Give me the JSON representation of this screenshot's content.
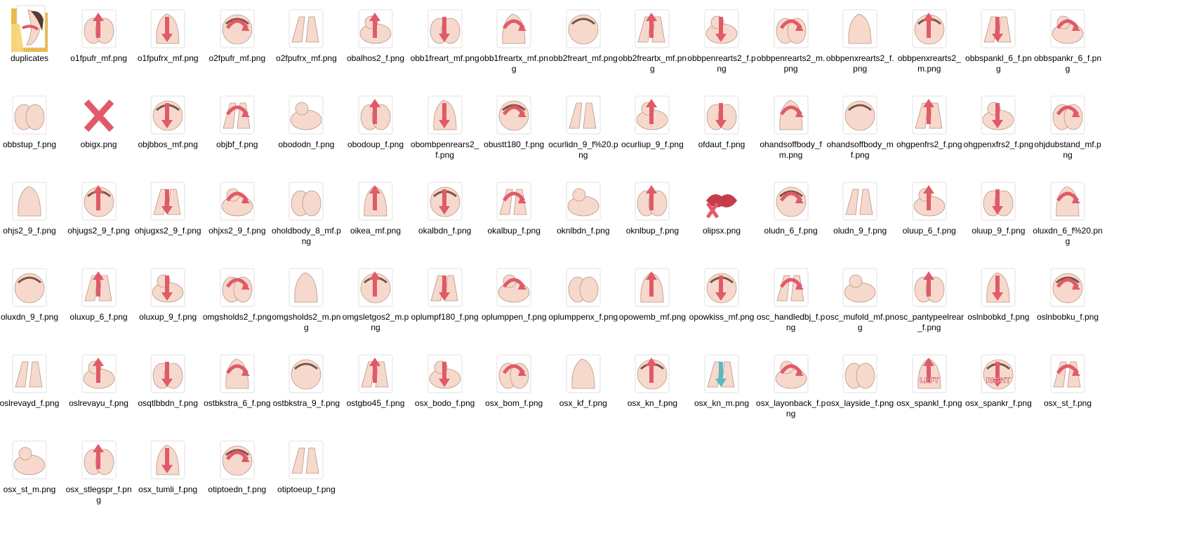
{
  "folder": {
    "label": "duplicates",
    "icon": "folder-icon"
  },
  "files": [
    {
      "name": "o1fpufr_mf.png",
      "icon": "image-thumbnail-icon"
    },
    {
      "name": "o1fpufrx_mf.png",
      "icon": "image-thumbnail-icon"
    },
    {
      "name": "o2fpufr_mf.png",
      "icon": "image-thumbnail-icon"
    },
    {
      "name": "o2fpufrx_mf.png",
      "icon": "image-thumbnail-icon"
    },
    {
      "name": "obalhos2_f.png",
      "icon": "image-thumbnail-icon"
    },
    {
      "name": "obb1freart_mf.png",
      "icon": "image-thumbnail-icon"
    },
    {
      "name": "obb1freartx_mf.png",
      "icon": "image-thumbnail-icon"
    },
    {
      "name": "obb2freart_mf.png",
      "icon": "image-thumbnail-icon"
    },
    {
      "name": "obb2freartx_mf.png",
      "icon": "image-thumbnail-icon"
    },
    {
      "name": "obbpenrearts2_f.png",
      "icon": "image-thumbnail-icon"
    },
    {
      "name": "obbpenrearts2_m.png",
      "icon": "image-thumbnail-icon"
    },
    {
      "name": "obbpenxrearts2_f.png",
      "icon": "image-thumbnail-icon"
    },
    {
      "name": "obbpenxrearts2_m.png",
      "icon": "image-thumbnail-icon"
    },
    {
      "name": "obbspankl_6_f.png",
      "icon": "image-thumbnail-icon"
    },
    {
      "name": "obbspankr_6_f.png",
      "icon": "image-thumbnail-icon"
    },
    {
      "name": "obbstup_f.png",
      "icon": "image-thumbnail-icon"
    },
    {
      "name": "obigx.png",
      "icon": "image-thumbnail-icon"
    },
    {
      "name": "objbbos_mf.png",
      "icon": "image-thumbnail-icon"
    },
    {
      "name": "objbf_f.png",
      "icon": "image-thumbnail-icon"
    },
    {
      "name": "obododn_f.png",
      "icon": "image-thumbnail-icon"
    },
    {
      "name": "obodoup_f.png",
      "icon": "image-thumbnail-icon"
    },
    {
      "name": "obombpenrears2_f.png",
      "icon": "image-thumbnail-icon"
    },
    {
      "name": "obustt180_f.png",
      "icon": "image-thumbnail-icon"
    },
    {
      "name": "ocurlidn_9_f%20.png",
      "icon": "image-thumbnail-icon"
    },
    {
      "name": "ocurliup_9_f.png",
      "icon": "image-thumbnail-icon"
    },
    {
      "name": "ofdaut_f.png",
      "icon": "image-thumbnail-icon"
    },
    {
      "name": "ohandsoffbody_fm.png",
      "icon": "image-thumbnail-icon"
    },
    {
      "name": "ohandsoffbody_mf.png",
      "icon": "image-thumbnail-icon"
    },
    {
      "name": "ohgpenfrs2_f.png",
      "icon": "image-thumbnail-icon"
    },
    {
      "name": "ohgpenxfrs2_f.png",
      "icon": "image-thumbnail-icon"
    },
    {
      "name": "ohjdubstand_mf.png",
      "icon": "image-thumbnail-icon"
    },
    {
      "name": "ohjs2_9_f.png",
      "icon": "image-thumbnail-icon"
    },
    {
      "name": "ohjugs2_9_f.png",
      "icon": "image-thumbnail-icon"
    },
    {
      "name": "ohjugxs2_9_f.png",
      "icon": "image-thumbnail-icon"
    },
    {
      "name": "ohjxs2_9_f.png",
      "icon": "image-thumbnail-icon"
    },
    {
      "name": "oholdbody_8_mf.png",
      "icon": "image-thumbnail-icon"
    },
    {
      "name": "oikea_mf.png",
      "icon": "image-thumbnail-icon"
    },
    {
      "name": "okalbdn_f.png",
      "icon": "image-thumbnail-icon"
    },
    {
      "name": "okalbup_f.png",
      "icon": "image-thumbnail-icon"
    },
    {
      "name": "oknlbdn_f.png",
      "icon": "image-thumbnail-icon"
    },
    {
      "name": "oknlbup_f.png",
      "icon": "image-thumbnail-icon"
    },
    {
      "name": "olipsx.png",
      "icon": "image-thumbnail-icon"
    },
    {
      "name": "oludn_6_f.png",
      "icon": "image-thumbnail-icon"
    },
    {
      "name": "oludn_9_f.png",
      "icon": "image-thumbnail-icon"
    },
    {
      "name": "oluup_6_f.png",
      "icon": "image-thumbnail-icon"
    },
    {
      "name": "oluup_9_f.png",
      "icon": "image-thumbnail-icon"
    },
    {
      "name": "oluxdn_6_f%20.png",
      "icon": "image-thumbnail-icon"
    },
    {
      "name": "oluxdn_9_f.png",
      "icon": "image-thumbnail-icon"
    },
    {
      "name": "oluxup_6_f.png",
      "icon": "image-thumbnail-icon"
    },
    {
      "name": "oluxup_9_f.png",
      "icon": "image-thumbnail-icon"
    },
    {
      "name": "omgsholds2_f.png",
      "icon": "image-thumbnail-icon"
    },
    {
      "name": "omgsholds2_m.png",
      "icon": "image-thumbnail-icon"
    },
    {
      "name": "omgsletgos2_m.png",
      "icon": "image-thumbnail-icon"
    },
    {
      "name": "oplumpf180_f.png",
      "icon": "image-thumbnail-icon"
    },
    {
      "name": "oplumppen_f.png",
      "icon": "image-thumbnail-icon"
    },
    {
      "name": "oplumppenx_f.png",
      "icon": "image-thumbnail-icon"
    },
    {
      "name": "opowemb_mf.png",
      "icon": "image-thumbnail-icon"
    },
    {
      "name": "opowkiss_mf.png",
      "icon": "image-thumbnail-icon"
    },
    {
      "name": "osc_handledbj_f.png",
      "icon": "image-thumbnail-icon"
    },
    {
      "name": "osc_mufold_mf.png",
      "icon": "image-thumbnail-icon"
    },
    {
      "name": "osc_pantypeelrear_f.png",
      "icon": "image-thumbnail-icon"
    },
    {
      "name": "oslnbobkd_f.png",
      "icon": "image-thumbnail-icon"
    },
    {
      "name": "oslnbobku_f.png",
      "icon": "image-thumbnail-icon"
    },
    {
      "name": "oslrevayd_f.png",
      "icon": "image-thumbnail-icon"
    },
    {
      "name": "oslrevayu_f.png",
      "icon": "image-thumbnail-icon"
    },
    {
      "name": "osqtlbbdn_f.png",
      "icon": "image-thumbnail-icon"
    },
    {
      "name": "ostbkstra_6_f.png",
      "icon": "image-thumbnail-icon"
    },
    {
      "name": "ostbkstra_9_f.png",
      "icon": "image-thumbnail-icon"
    },
    {
      "name": "ostgbo45_f.png",
      "icon": "image-thumbnail-icon"
    },
    {
      "name": "osx_bodo_f.png",
      "icon": "image-thumbnail-icon"
    },
    {
      "name": "osx_bom_f.png",
      "icon": "image-thumbnail-icon"
    },
    {
      "name": "osx_kf_f.png",
      "icon": "image-thumbnail-icon"
    },
    {
      "name": "osx_kn_f.png",
      "icon": "image-thumbnail-icon"
    },
    {
      "name": "osx_kn_m.png",
      "icon": "image-thumbnail-icon"
    },
    {
      "name": "osx_layonback_f.png",
      "icon": "image-thumbnail-icon"
    },
    {
      "name": "osx_layside_f.png",
      "icon": "image-thumbnail-icon"
    },
    {
      "name": "osx_spankl_f.png",
      "icon": "image-thumbnail-icon",
      "thumb_text": "LEFT"
    },
    {
      "name": "osx_spankr_f.png",
      "icon": "image-thumbnail-icon",
      "thumb_text": "RIGHT"
    },
    {
      "name": "osx_st_f.png",
      "icon": "image-thumbnail-icon"
    },
    {
      "name": "osx_st_m.png",
      "icon": "image-thumbnail-icon"
    },
    {
      "name": "osx_stlegspr_f.png",
      "icon": "image-thumbnail-icon"
    },
    {
      "name": "osx_tumli_f.png",
      "icon": "image-thumbnail-icon"
    },
    {
      "name": "otiptoedn_f.png",
      "icon": "image-thumbnail-icon"
    },
    {
      "name": "otiptoeup_f.png",
      "icon": "image-thumbnail-icon"
    }
  ],
  "colors": {
    "skin": "#f6d9cc",
    "skin_outline": "#b99585",
    "accent": "#e05a68",
    "accent_dark": "#c63c4c",
    "teal": "#5bb8c9",
    "folder": "#e9b94a",
    "folder_light": "#f7d67a"
  }
}
